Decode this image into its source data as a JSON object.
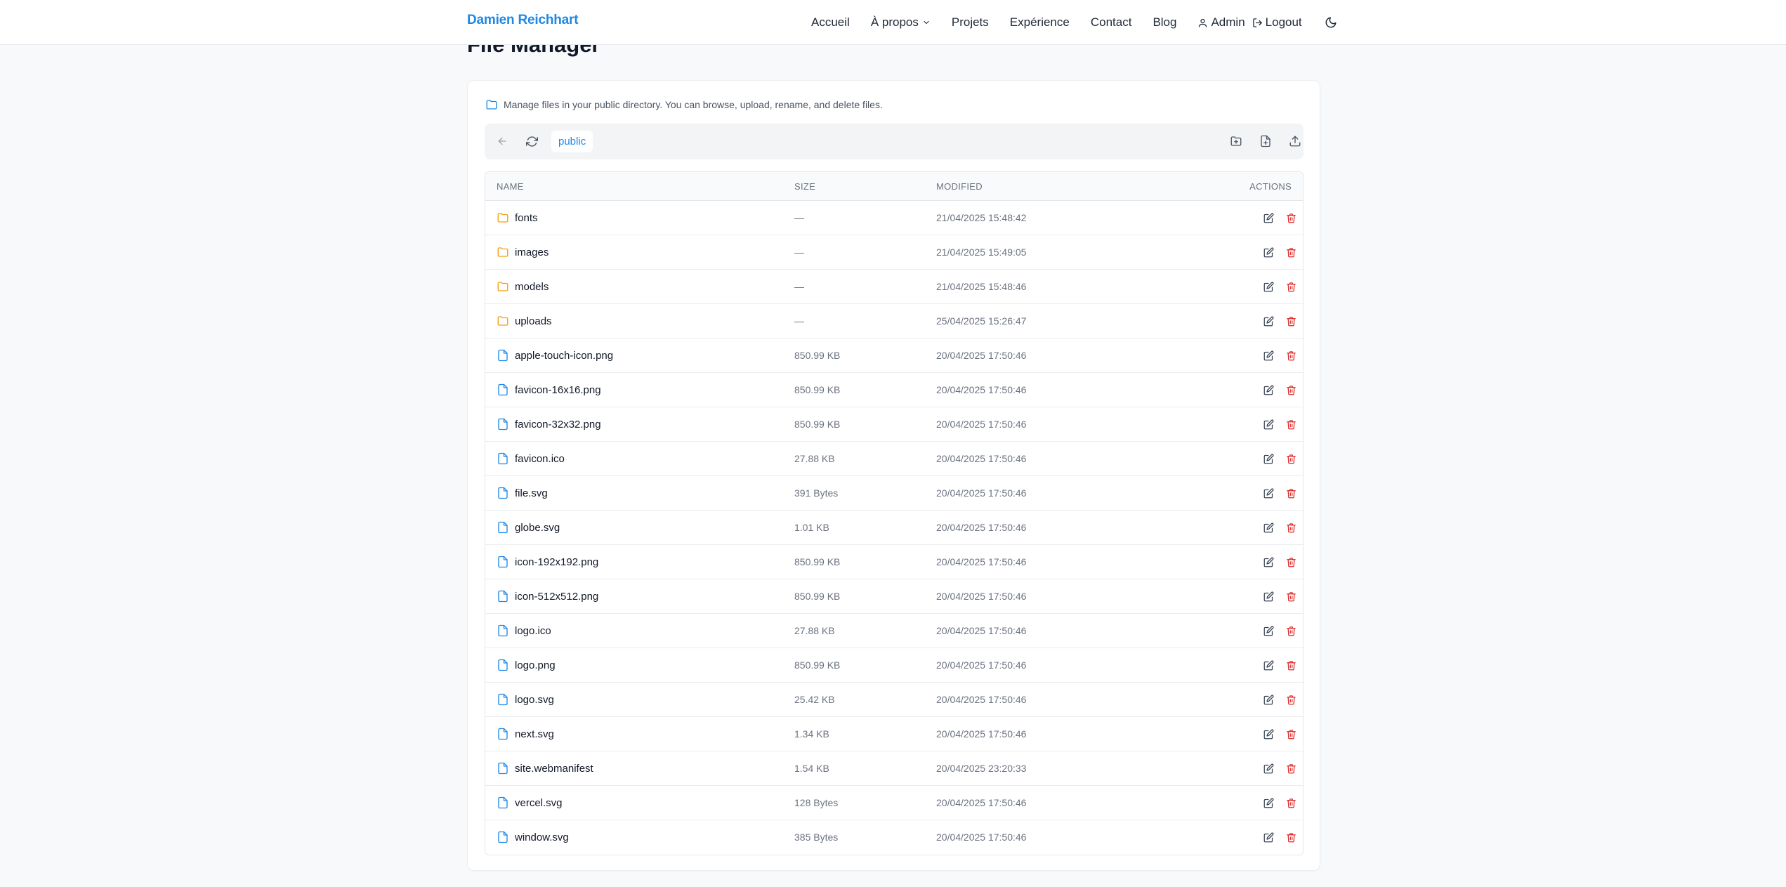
{
  "nav": {
    "brand": "Damien Reichhart",
    "links": [
      "Accueil",
      "À propos",
      "Projets",
      "Expérience",
      "Contact",
      "Blog"
    ],
    "user_label": "Admin",
    "logout_label": "Logout",
    "theme_icon": "moon-icon"
  },
  "page": {
    "title": "File Manager"
  },
  "manager": {
    "description": "Manage files in your public directory. You can browse, upload, rename, and delete files.",
    "breadcrumb": "public",
    "toolbar_icons": [
      "back-arrow-icon",
      "refresh-icon",
      "new-folder-icon",
      "new-file-icon",
      "upload-icon"
    ],
    "columns": {
      "name": "Name",
      "size": "Size",
      "modified": "Modified",
      "actions": "Actions"
    },
    "rows": [
      {
        "type": "folder",
        "name": "fonts",
        "size": "—",
        "modified": "21/04/2025 15:48:42"
      },
      {
        "type": "folder",
        "name": "images",
        "size": "—",
        "modified": "21/04/2025 15:49:05"
      },
      {
        "type": "folder",
        "name": "models",
        "size": "—",
        "modified": "21/04/2025 15:48:46"
      },
      {
        "type": "folder",
        "name": "uploads",
        "size": "—",
        "modified": "25/04/2025 15:26:47"
      },
      {
        "type": "file",
        "name": "apple-touch-icon.png",
        "size": "850.99 KB",
        "modified": "20/04/2025 17:50:46"
      },
      {
        "type": "file",
        "name": "favicon-16x16.png",
        "size": "850.99 KB",
        "modified": "20/04/2025 17:50:46"
      },
      {
        "type": "file",
        "name": "favicon-32x32.png",
        "size": "850.99 KB",
        "modified": "20/04/2025 17:50:46"
      },
      {
        "type": "file",
        "name": "favicon.ico",
        "size": "27.88 KB",
        "modified": "20/04/2025 17:50:46"
      },
      {
        "type": "file",
        "name": "file.svg",
        "size": "391 Bytes",
        "modified": "20/04/2025 17:50:46"
      },
      {
        "type": "file",
        "name": "globe.svg",
        "size": "1.01 KB",
        "modified": "20/04/2025 17:50:46"
      },
      {
        "type": "file",
        "name": "icon-192x192.png",
        "size": "850.99 KB",
        "modified": "20/04/2025 17:50:46"
      },
      {
        "type": "file",
        "name": "icon-512x512.png",
        "size": "850.99 KB",
        "modified": "20/04/2025 17:50:46"
      },
      {
        "type": "file",
        "name": "logo.ico",
        "size": "27.88 KB",
        "modified": "20/04/2025 17:50:46"
      },
      {
        "type": "file",
        "name": "logo.png",
        "size": "850.99 KB",
        "modified": "20/04/2025 17:50:46"
      },
      {
        "type": "file",
        "name": "logo.svg",
        "size": "25.42 KB",
        "modified": "20/04/2025 17:50:46"
      },
      {
        "type": "file",
        "name": "next.svg",
        "size": "1.34 KB",
        "modified": "20/04/2025 17:50:46"
      },
      {
        "type": "file",
        "name": "site.webmanifest",
        "size": "1.54 KB",
        "modified": "20/04/2025 23:20:33"
      },
      {
        "type": "file",
        "name": "vercel.svg",
        "size": "128 Bytes",
        "modified": "20/04/2025 17:50:46"
      },
      {
        "type": "file",
        "name": "window.svg",
        "size": "385 Bytes",
        "modified": "20/04/2025 17:50:46"
      }
    ]
  },
  "colors": {
    "accent": "#1e88e5",
    "folder": "#f59e0b",
    "danger": "#dc2626"
  }
}
